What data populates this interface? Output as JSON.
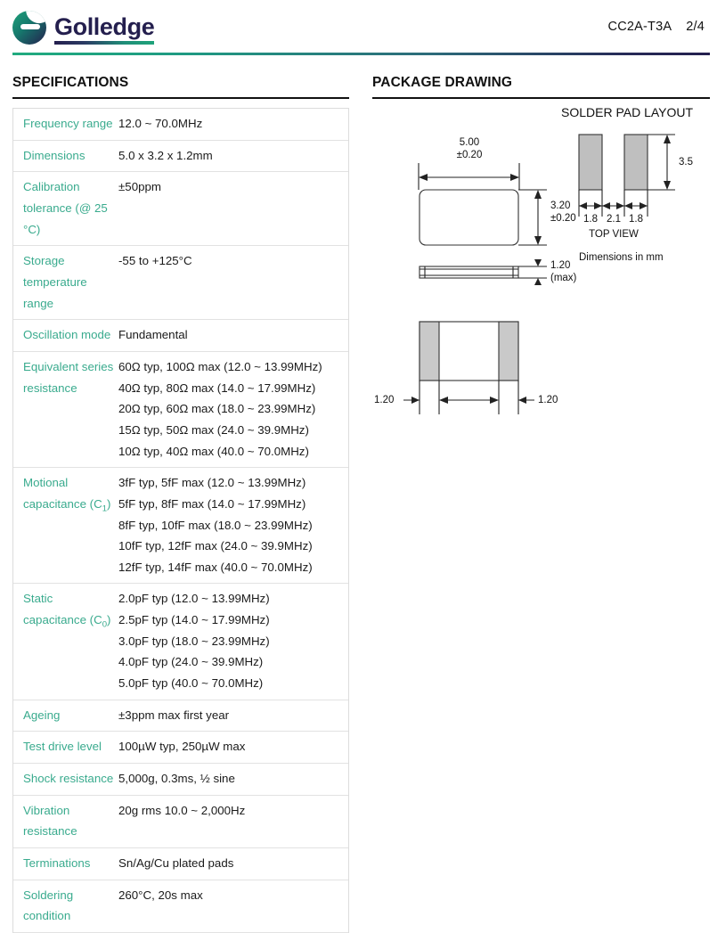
{
  "header": {
    "brand_name": "Golledge",
    "logo_icon": "golledge-circle-logo",
    "part_number": "CC2A-T3A",
    "page_number": "2/4",
    "accent_teal": "#21ab7f",
    "accent_navy": "#241f4e"
  },
  "specifications": {
    "title": "SPECIFICATIONS",
    "label_color": "#3aab8e",
    "rows": [
      {
        "label": "Frequency range",
        "values": [
          "12.0 ~ 70.0MHz"
        ]
      },
      {
        "label": "Dimensions",
        "values": [
          "5.0 x 3.2 x 1.2mm"
        ]
      },
      {
        "label_html": "Calibration tolerance (@ 25&#8201;&deg;C)",
        "label": "Calibration tolerance (@ 25 °C)",
        "values": [
          "±50ppm"
        ]
      },
      {
        "label": "Storage temperature range",
        "values": [
          "-55 to +125°C"
        ]
      },
      {
        "label": "Oscillation mode",
        "values": [
          "Fundamental"
        ]
      },
      {
        "label": "Equivalent series resistance",
        "values": [
          "60Ω typ, 100Ω max (12.0 ~ 13.99MHz)",
          "40Ω typ, 80Ω max (14.0 ~ 17.99MHz)",
          "20Ω typ, 60Ω max (18.0 ~ 23.99MHz)",
          "15Ω typ, 50Ω max (24.0 ~ 39.9MHz)",
          "10Ω typ, 40Ω max (40.0 ~ 70.0MHz)"
        ]
      },
      {
        "label_html": "Motional capacitance (C<sub>1</sub>)",
        "label": "Motional capacitance (C1)",
        "values": [
          "3fF typ, 5fF max (12.0 ~ 13.99MHz)",
          "5fF typ, 8fF max (14.0 ~ 17.99MHz)",
          "8fF typ, 10fF max (18.0 ~ 23.99MHz)",
          "10fF typ, 12fF max (24.0 ~ 39.9MHz)",
          "12fF typ, 14fF max (40.0 ~ 70.0MHz)"
        ]
      },
      {
        "label_html": "Static capacitance (C<sub>0</sub>)",
        "label": "Static capacitance (C0)",
        "values": [
          "2.0pF typ (12.0 ~ 13.99MHz)",
          "2.5pF typ (14.0 ~ 17.99MHz)",
          "3.0pF typ (18.0 ~ 23.99MHz)",
          "4.0pF typ (24.0 ~ 39.9MHz)",
          "5.0pF typ (40.0 ~ 70.0MHz)"
        ]
      },
      {
        "label": "Ageing",
        "values": [
          "±3ppm max first year"
        ]
      },
      {
        "label": "Test drive level",
        "values": [
          "100µW typ, 250µW max"
        ]
      },
      {
        "label": "Shock resistance",
        "values": [
          "5,000g, 0.3ms, ½ sine"
        ]
      },
      {
        "label": "Vibration resistance",
        "values": [
          "20g rms 10.0 ~ 2,000Hz"
        ]
      },
      {
        "label": "Terminations",
        "values": [
          "Sn/Ag/Cu plated pads"
        ]
      },
      {
        "label": "Soldering condition",
        "values": [
          "260°C, 20s max"
        ]
      }
    ]
  },
  "package_drawing": {
    "title": "PACKAGE DRAWING",
    "top_view": {
      "width_dim": "5.00",
      "width_tol": "±0.20",
      "height_dim": "3.20",
      "height_tol": "±0.20"
    },
    "side_view": {
      "thickness_dim": "1.20",
      "thickness_note": "(max)"
    },
    "bottom_view": {
      "pad_left_dim": "1.20",
      "pad_right_dim": "1.20"
    },
    "solder_pad_layout": {
      "title": "SOLDER PAD LAYOUT",
      "pad_height": "3.5",
      "dim_left": "1.8",
      "dim_middle": "2.1",
      "dim_right": "1.8",
      "view_label": "TOP VIEW",
      "units_note": "Dimensions in mm",
      "pad_fill": "#bfbfbf"
    }
  }
}
